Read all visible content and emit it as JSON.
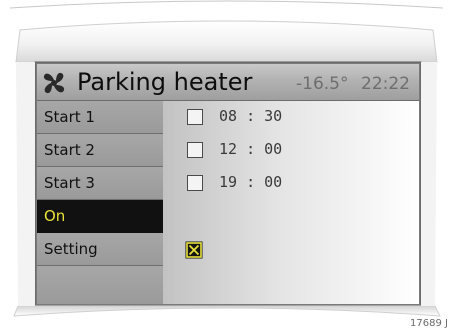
{
  "header": {
    "title": "Parking heater",
    "icon": "fan-icon",
    "outside_temperature": "-16.5°",
    "clock": "22:22"
  },
  "menu": {
    "items": [
      {
        "label": "Start 1",
        "selected": false
      },
      {
        "label": "Start 2",
        "selected": false
      },
      {
        "label": "Start 3",
        "selected": false
      },
      {
        "label": "On",
        "selected": true
      },
      {
        "label": "Setting",
        "selected": false
      },
      {
        "label": "",
        "selected": false
      }
    ]
  },
  "timers": [
    {
      "time": "08 : 30",
      "checked": false
    },
    {
      "time": "12 : 00",
      "checked": false
    },
    {
      "time": "19 : 00",
      "checked": false
    }
  ],
  "on_toggle": {
    "checked": true,
    "color": "#e8e23a"
  },
  "colors": {
    "selection_background": "#111111",
    "selection_text": "#e8e23a"
  },
  "figure_code": "17689 J"
}
